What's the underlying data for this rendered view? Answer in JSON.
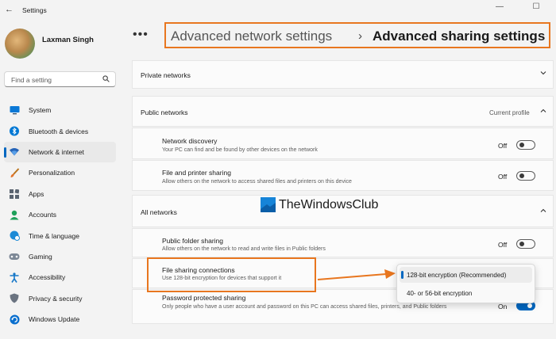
{
  "window": {
    "title": "Settings",
    "back": "←",
    "minimize": "—",
    "maximize": "☐"
  },
  "user": {
    "name": "Laxman Singh"
  },
  "search": {
    "placeholder": "Find a setting"
  },
  "sidebar": {
    "items": [
      {
        "label": "System",
        "icon": "monitor-icon",
        "color": "#0067c0"
      },
      {
        "label": "Bluetooth & devices",
        "icon": "bluetooth-icon",
        "color": "#0078d4"
      },
      {
        "label": "Network & internet",
        "icon": "wifi-icon",
        "color": "#1a5fb4",
        "active": true
      },
      {
        "label": "Personalization",
        "icon": "brush-icon",
        "color": "#e3742c"
      },
      {
        "label": "Apps",
        "icon": "apps-icon",
        "color": "#5a6470"
      },
      {
        "label": "Accounts",
        "icon": "person-icon",
        "color": "#1fa05a"
      },
      {
        "label": "Time & language",
        "icon": "globe-clock-icon",
        "color": "#1c8ad6"
      },
      {
        "label": "Gaming",
        "icon": "gamepad-icon",
        "color": "#7d8896"
      },
      {
        "label": "Accessibility",
        "icon": "accessibility-icon",
        "color": "#1677c8"
      },
      {
        "label": "Privacy & security",
        "icon": "shield-icon",
        "color": "#6a7380"
      },
      {
        "label": "Windows Update",
        "icon": "update-icon",
        "color": "#0a6fce"
      }
    ]
  },
  "breadcrumb": {
    "dots": "•••",
    "parent": "Advanced network settings",
    "separator": "›",
    "current": "Advanced sharing settings"
  },
  "sections": {
    "private": {
      "title": "Private networks"
    },
    "public": {
      "title": "Public networks",
      "status": "Current profile",
      "rows": [
        {
          "title": "Network discovery",
          "desc": "Your PC can find and be found by other devices on the network",
          "state": "Off"
        },
        {
          "title": "File and printer sharing",
          "desc": "Allow others on the network to access shared files and printers on this device",
          "state": "Off"
        }
      ]
    },
    "all": {
      "title": "All networks",
      "rows": [
        {
          "title": "Public folder sharing",
          "desc": "Allow others on the network to read and write files in Public folders",
          "state": "Off"
        },
        {
          "title": "File sharing connections",
          "desc": "Use 128-bit encryption for devices that support it"
        },
        {
          "title": "Password protected sharing",
          "desc": "Only people who have a user account and password on this PC can access shared files, printers, and Public folders",
          "state": "On"
        }
      ]
    }
  },
  "dropdown": {
    "options": [
      {
        "label": "128-bit encryption (Recommended)",
        "selected": true
      },
      {
        "label": "40- or 56-bit encryption",
        "selected": false
      }
    ]
  },
  "watermark": {
    "text": "TheWindowsClub"
  },
  "colors": {
    "accent": "#0067c0",
    "highlight": "#e8761f"
  }
}
